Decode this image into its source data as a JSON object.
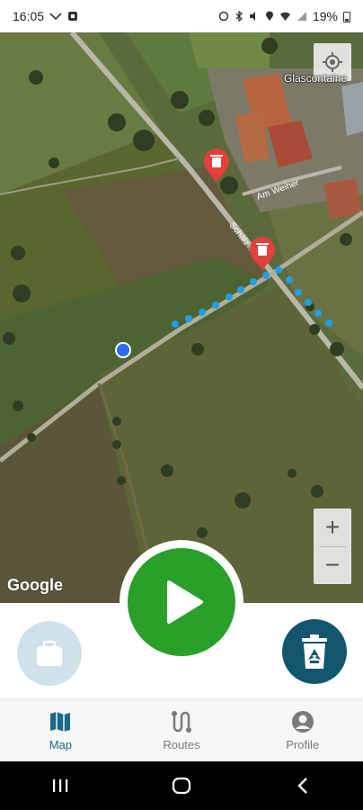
{
  "status_bar": {
    "time": "16:05",
    "battery": "19%"
  },
  "map": {
    "poi_label": "Glascontaine",
    "road_label_1": "Am Weiher",
    "road_label_2": "Schälz…str",
    "attribution": "Google",
    "zoom_in_label": "+",
    "zoom_out_label": "−",
    "marker_icon": "trash-can-icon",
    "route_color": "#1e9fea",
    "marker_color": "#e2403a"
  },
  "actions": {
    "play_color": "#2aa02a",
    "recycle_color": "#12566e",
    "bag_color": "#cfe1ea"
  },
  "bottom_nav": {
    "items": [
      {
        "label": "Map",
        "icon": "map-icon",
        "active": true
      },
      {
        "label": "Routes",
        "icon": "routes-icon",
        "active": false
      },
      {
        "label": "Profile",
        "icon": "profile-icon",
        "active": false
      }
    ]
  }
}
